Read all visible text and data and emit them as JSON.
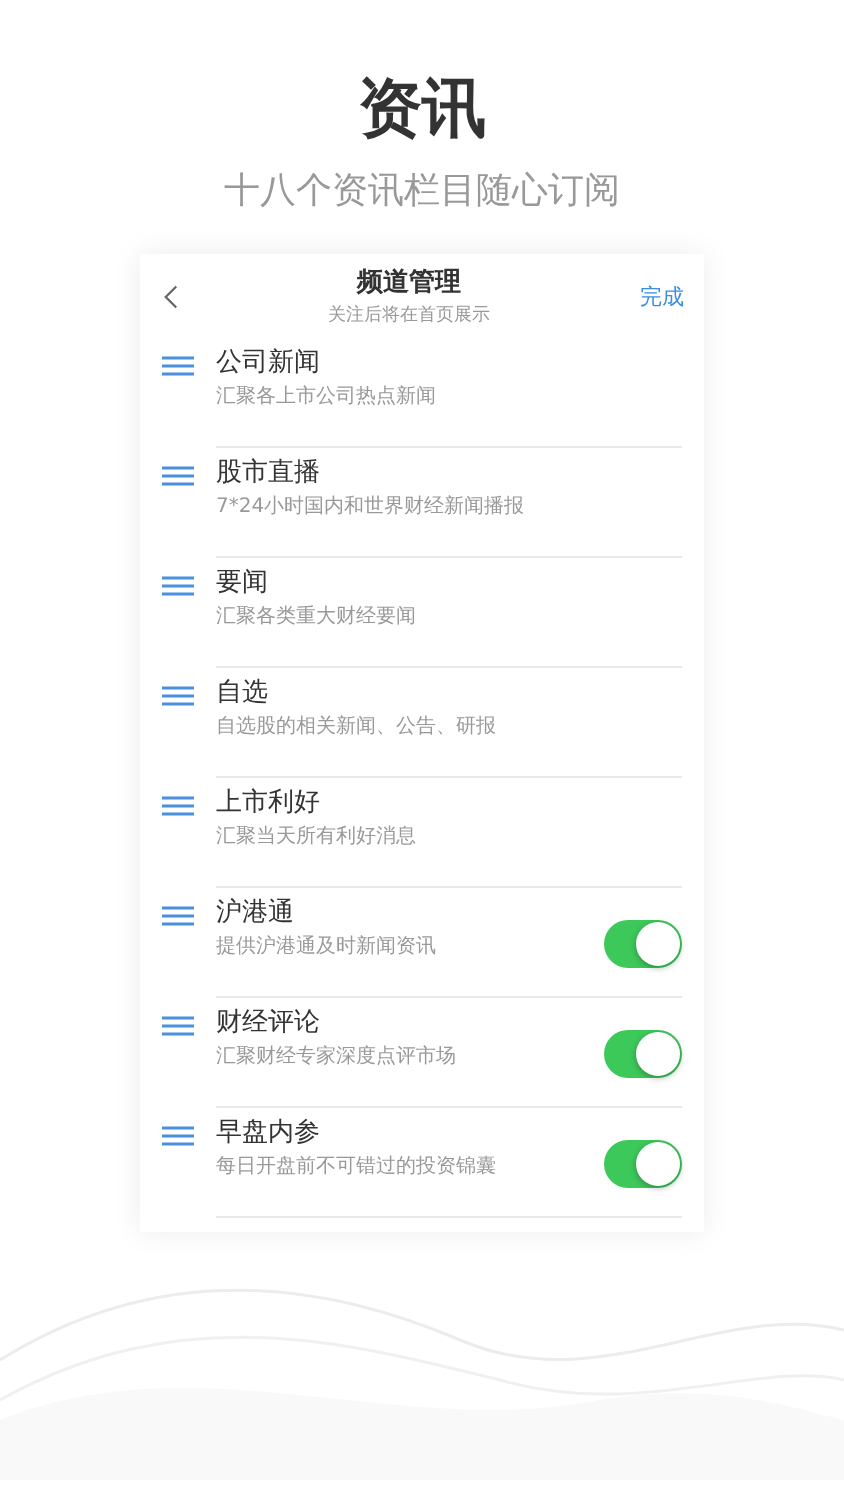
{
  "heading": {
    "title": "资讯",
    "subtitle": "十八个资讯栏目随心订阅"
  },
  "panel": {
    "title": "频道管理",
    "subtitle": "关注后将在首页展示",
    "done": "完成"
  },
  "channels": [
    {
      "name": "公司新闻",
      "desc": "汇聚各上市公司热点新闻",
      "kind": "plain"
    },
    {
      "name": "股市直播",
      "desc": "7*24小时国内和世界财经新闻播报",
      "kind": "plain"
    },
    {
      "name": "要闻",
      "desc": "汇聚各类重大财经要闻",
      "kind": "plain"
    },
    {
      "name": "自选",
      "desc": "自选股的相关新闻、公告、研报",
      "kind": "plain"
    },
    {
      "name": "上市利好",
      "desc": "汇聚当天所有利好消息",
      "kind": "plain"
    },
    {
      "name": "沪港通",
      "desc": "提供沪港通及时新闻资讯",
      "kind": "switch",
      "on": true
    },
    {
      "name": "财经评论",
      "desc": "汇聚财经专家深度点评市场",
      "kind": "switch",
      "on": true
    },
    {
      "name": "早盘内参",
      "desc": "每日开盘前不可错过的投资锦囊",
      "kind": "switch",
      "on": true
    }
  ]
}
